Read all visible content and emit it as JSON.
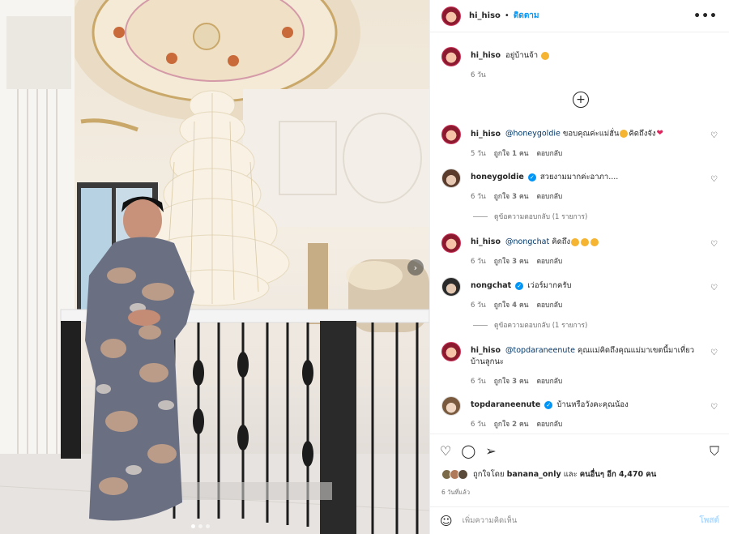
{
  "post": {
    "username": "hi_hiso",
    "follow_label": "ติดตาม",
    "more_label": "•••",
    "caption_text": "อยู่บ้านจ้า",
    "caption_time": "6 วัน",
    "load_more_label": "+",
    "next_label": "›"
  },
  "comments": [
    {
      "user": "hi_hiso",
      "verified": false,
      "mention": "@honeygoldie",
      "text": "ขอบคุณค่ะแม่ฮั่น",
      "text2": "คิดถึงจัง",
      "time": "5 วัน",
      "likes": "ถูกใจ 1 คน",
      "reply": "ตอบกลับ"
    },
    {
      "user": "honeygoldie",
      "verified": true,
      "mention": "",
      "text": "สวยงามมากค่ะอาภา....",
      "time": "6 วัน",
      "likes": "ถูกใจ 3 คน",
      "reply": "ตอบกลับ",
      "view_replies": "ดูข้อความตอบกลับ (1 รายการ)"
    },
    {
      "user": "hi_hiso",
      "verified": false,
      "mention": "@nongchat",
      "text": "คิดถึง",
      "time": "6 วัน",
      "likes": "ถูกใจ 3 คน",
      "reply": "ตอบกลับ"
    },
    {
      "user": "nongchat",
      "verified": true,
      "mention": "",
      "text": "เว่อร์มากครับ",
      "time": "6 วัน",
      "likes": "ถูกใจ 4 คน",
      "reply": "ตอบกลับ",
      "view_replies": "ดูข้อความตอบกลับ (1 รายการ)"
    },
    {
      "user": "hi_hiso",
      "verified": false,
      "mention": "@topdaraneenute",
      "text": "คุณแม่คิดถึงคุณแม่มาเขตนี้มาเที่ยวบ้านลูกนะ",
      "time": "6 วัน",
      "likes": "ถูกใจ 3 คน",
      "reply": "ตอบกลับ"
    },
    {
      "user": "topdaraneenute",
      "verified": true,
      "mention": "",
      "text": "บ้านหรือวังคะคุณน้อง",
      "time": "6 วัน",
      "likes": "ถูกใจ 2 คน",
      "reply": "ตอบกลับ"
    }
  ],
  "actions": {
    "like_icon": "heart-icon",
    "comment_icon": "comment-icon",
    "share_icon": "share-icon",
    "save_icon": "bookmark-icon"
  },
  "likes_summary": {
    "prefix": "ถูกใจโดย",
    "first_user": "banana_only",
    "joiner": "และ",
    "others": "คนอื่นๆ อีก 4,470 คน"
  },
  "posted_time": "6 วันที่แล้ว",
  "add_comment": {
    "placeholder": "เพิ่มความคิดเห็น",
    "post_label": "โพสต์"
  }
}
